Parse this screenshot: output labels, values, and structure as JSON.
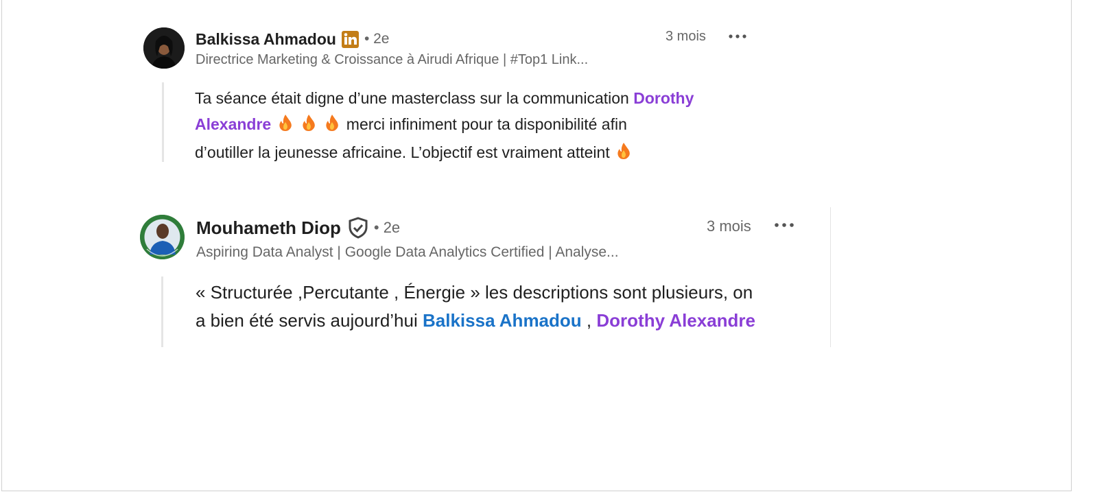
{
  "comments": [
    {
      "author": "Balkissa Ahmadou",
      "degree": "• 2e",
      "headline": "Directrice Marketing & Croissance à Airudi Afrique | #Top1 Link...",
      "time": "3 mois",
      "badge_icon": "linkedin-icon",
      "text_1": "Ta séance était digne d’une masterclass sur la communication",
      "mention_1": "Dorothy",
      "mention_2": "Alexandre",
      "text_2": "merci infiniment pour ta disponibilité afin",
      "text_3": "d’outiller la jeunesse africaine. L’objectif est vraiment atteint",
      "emoji_icon": "fire-icon"
    },
    {
      "author": "Mouhameth Diop",
      "degree": "• 2e",
      "headline": "Aspiring Data Analyst | Google Data Analytics Certified | Analyse...",
      "time": "3 mois",
      "badge_icon": "verified-shield-icon",
      "text_1": "« Structurée ,Percutante , Énergie » les descriptions sont plusieurs, on",
      "text_2": "a bien été servis aujourd’hui",
      "mention_1": "Balkissa Ahmadou",
      "separator": ",",
      "mention_2": "Dorothy Alexandre"
    }
  ],
  "colors": {
    "mention_purple": "#8a3ed6",
    "mention_blue": "#1a73c8",
    "linkedin_badge": "#c37d16",
    "muted": "#666666"
  }
}
